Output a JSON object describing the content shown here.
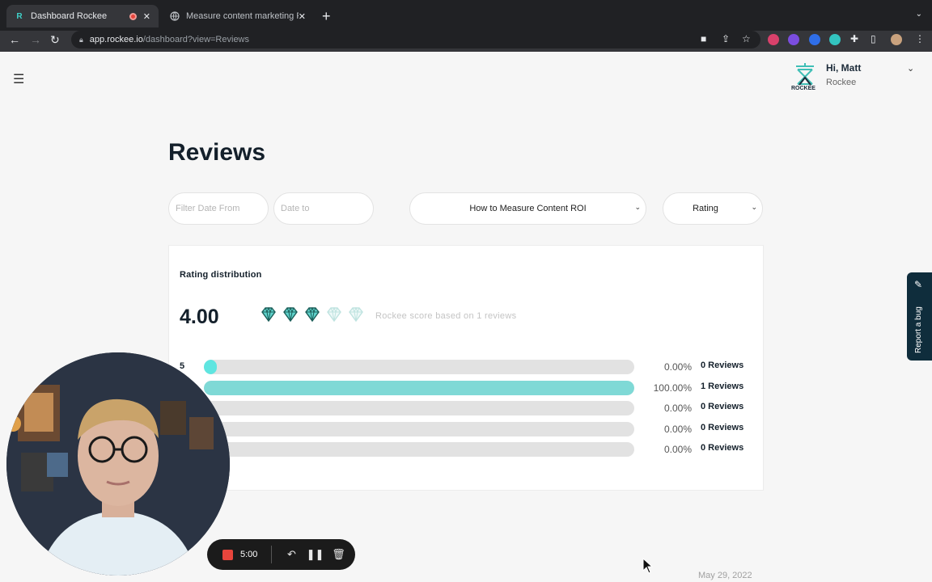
{
  "browser": {
    "tabs": [
      {
        "title": "Dashboard Rockee",
        "active": true,
        "recording": true
      },
      {
        "title": "Measure content marketing RO",
        "active": false
      }
    ],
    "url_host": "app.rockee.io",
    "url_path": "/dashboard?view=Reviews"
  },
  "header": {
    "greeting": "Hi, Matt",
    "org": "Rockee",
    "logo_text": "ROCKEE"
  },
  "page": {
    "title": "Reviews"
  },
  "filters": {
    "date_from_placeholder": "Filter Date From",
    "date_to_placeholder": "Date to",
    "article": "How to Measure Content ROI",
    "rating": "Rating"
  },
  "rating_distribution": {
    "title": "Rating distribution",
    "score": "4.00",
    "gems_filled": 3,
    "gems_total": 5,
    "caption": "Rockee score based on 1 reviews",
    "rows": [
      {
        "label": "5",
        "percent": "0.00%",
        "count": "0 Reviews",
        "value": 0
      },
      {
        "label": "",
        "percent": "100.00%",
        "count": "1 Reviews",
        "value": 100
      },
      {
        "label": "",
        "percent": "0.00%",
        "count": "0 Reviews",
        "value": 0
      },
      {
        "label": "",
        "percent": "0.00%",
        "count": "0 Reviews",
        "value": 0
      },
      {
        "label": "",
        "percent": "0.00%",
        "count": "0 Reviews",
        "value": 0
      }
    ]
  },
  "report_bug": {
    "label": "Report a bug"
  },
  "recorder": {
    "time": "5:00"
  },
  "review_date": "May 29, 2022",
  "colors": {
    "accent": "#7fd9d6",
    "dark": "#14202b",
    "record": "#e8453c"
  }
}
